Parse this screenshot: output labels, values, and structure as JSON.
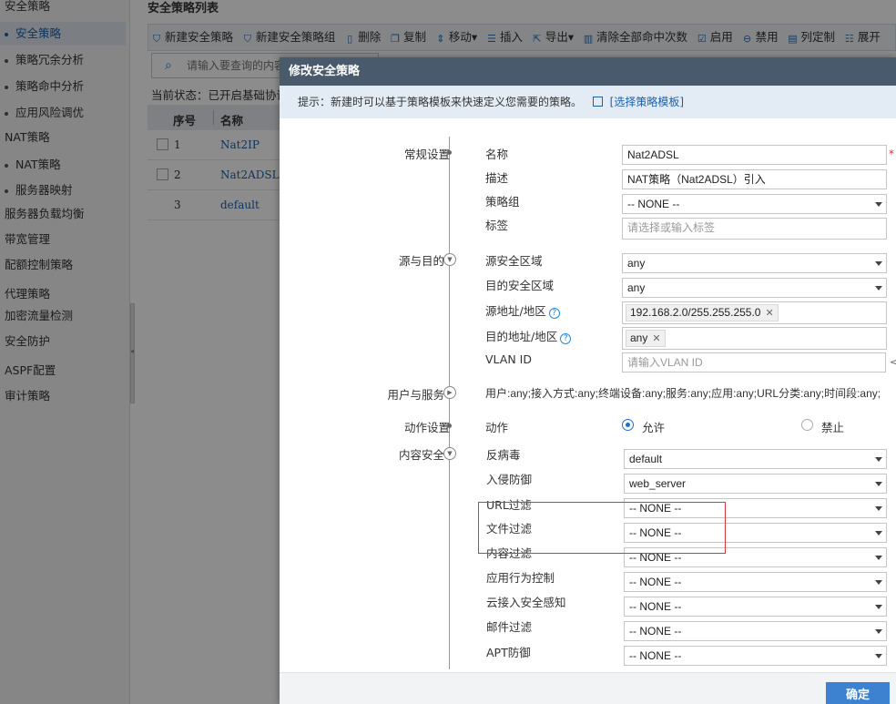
{
  "sidebar": {
    "items": [
      {
        "label": "安全策略",
        "kind": "cat"
      },
      {
        "label": "安全策略",
        "kind": "sub",
        "active": true
      },
      {
        "label": "策略冗余分析",
        "kind": "sub"
      },
      {
        "label": "策略命中分析",
        "kind": "sub"
      },
      {
        "label": "应用风险调优",
        "kind": "sub"
      },
      {
        "label": "NAT策略",
        "kind": "cat"
      },
      {
        "label": "NAT策略",
        "kind": "sub"
      },
      {
        "label": "服务器映射",
        "kind": "sub"
      },
      {
        "label": "服务器负载均衡",
        "kind": "cat"
      },
      {
        "label": "带宽管理",
        "kind": "cat"
      },
      {
        "label": "配额控制策略",
        "kind": "cat"
      },
      {
        "label": "代理策略",
        "kind": "cat"
      },
      {
        "label": "加密流量检测",
        "kind": "cat"
      },
      {
        "label": "安全防护",
        "kind": "cat"
      },
      {
        "label": "ASPF配置",
        "kind": "cat"
      },
      {
        "label": "审计策略",
        "kind": "cat"
      }
    ]
  },
  "main": {
    "title": "安全策略列表",
    "toolbar": [
      {
        "label": "新建安全策略",
        "icon": "shield-plus-icon"
      },
      {
        "label": "新建安全策略组",
        "icon": "shield-group-icon"
      },
      {
        "label": "删除",
        "icon": "trash-icon"
      },
      {
        "label": "复制",
        "icon": "copy-icon"
      },
      {
        "label": "移动▾",
        "icon": "move-icon"
      },
      {
        "label": "插入",
        "icon": "insert-icon"
      },
      {
        "label": "导出▾",
        "icon": "export-icon"
      },
      {
        "label": "清除全部命中次数",
        "icon": "clear-hits-icon"
      },
      {
        "label": "启用",
        "icon": "enable-icon"
      },
      {
        "label": "禁用",
        "icon": "disable-icon"
      },
      {
        "label": "列定制",
        "icon": "columns-icon"
      },
      {
        "label": "展开",
        "icon": "expand-icon"
      }
    ],
    "search_placeholder": "请输入要查询的内容",
    "status_text": "当前状态：已开启基础协议",
    "table": {
      "headers": [
        "序号",
        "名称"
      ],
      "rows": [
        {
          "num": "1",
          "name": "Nat2IP"
        },
        {
          "num": "2",
          "name": "Nat2ADSL"
        },
        {
          "num": "3",
          "name": "default"
        }
      ]
    }
  },
  "dialog": {
    "title": "修改安全策略",
    "tip": "提示：新建时可以基于策略模板来快速定义您需要的策略。",
    "template_link": "[选择策略模板]",
    "sections": {
      "general": "常规设置",
      "src_dst": "源与目的",
      "user_service": "用户与服务",
      "action": "动作设置",
      "content": "内容安全"
    },
    "fields": {
      "name_label": "名称",
      "name_value": "Nat2ADSL",
      "desc_label": "描述",
      "desc_value": "NAT策略（Nat2ADSL）引入",
      "group_label": "策略组",
      "group_value": "-- NONE --",
      "tag_label": "标签",
      "tag_placeholder": "请选择或输入标签",
      "src_zone_label": "源安全区域",
      "src_zone_value": "any",
      "dst_zone_label": "目的安全区域",
      "dst_zone_value": "any",
      "src_addr_label": "源地址/地区",
      "src_addr_tag": "192.168.2.0/255.255.255.0",
      "dst_addr_label": "目的地址/地区",
      "dst_addr_tag": "any",
      "vlan_label": "VLAN ID",
      "vlan_placeholder": "请输入VLAN ID",
      "user_service_summary": "用户:any;接入方式:any;终端设备:any;服务:any;应用:any;URL分类:any;时间段:any;",
      "action_label": "动作",
      "action_permit": "允许",
      "action_deny": "禁止"
    },
    "content_security": [
      {
        "label": "反病毒",
        "value": "default"
      },
      {
        "label": "入侵防御",
        "value": "web_server"
      },
      {
        "label": "URL过滤",
        "value": "-- NONE --"
      },
      {
        "label": "文件过滤",
        "value": "-- NONE --"
      },
      {
        "label": "内容过滤",
        "value": "-- NONE --"
      },
      {
        "label": "应用行为控制",
        "value": "-- NONE --"
      },
      {
        "label": "云接入安全感知",
        "value": "-- NONE --"
      },
      {
        "label": "邮件过滤",
        "value": "-- NONE --"
      },
      {
        "label": "APT防御",
        "value": "-- NONE --"
      }
    ],
    "ok_label": "确定",
    "required_mark": "*"
  },
  "colors": {
    "accent": "#1e5fa8",
    "dialog_title_bg": "#4a5a6d",
    "ok_button": "#3c82d0",
    "highlight": "#d9363e"
  }
}
